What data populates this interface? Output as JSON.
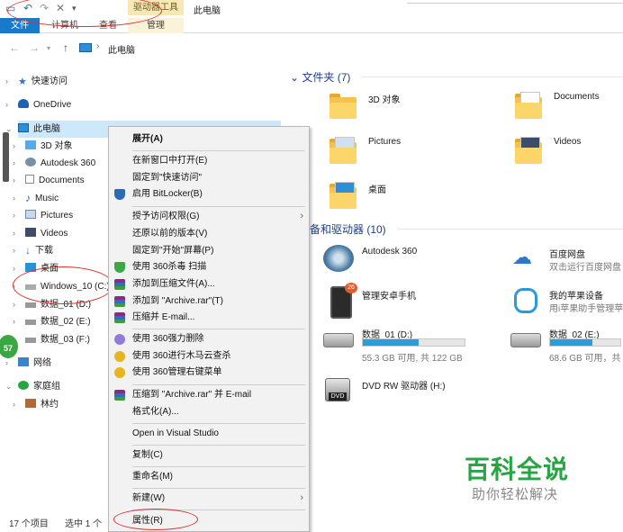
{
  "ribbon": {
    "context_group": "驱动器工具",
    "window_title": "此电脑",
    "tabs": [
      "文件",
      "计算机",
      "查看",
      "管理"
    ]
  },
  "address": {
    "path": "此电脑"
  },
  "nav": {
    "items": [
      {
        "label": "快速访问",
        "icon": "star-icon"
      },
      {
        "label": "OneDrive",
        "icon": "cloud-icon"
      },
      {
        "label": "此电脑",
        "icon": "pc-icon"
      },
      {
        "label": "3D 对象",
        "icon": "3d-objects-icon"
      },
      {
        "label": "Autodesk 360",
        "icon": "autodesk-icon"
      },
      {
        "label": "Documents",
        "icon": "document-icon"
      },
      {
        "label": "Music",
        "icon": "music-icon"
      },
      {
        "label": "Pictures",
        "icon": "pictures-icon"
      },
      {
        "label": "Videos",
        "icon": "videos-icon"
      },
      {
        "label": "下载",
        "icon": "download-icon"
      },
      {
        "label": "桌面",
        "icon": "desktop-icon"
      },
      {
        "label": "Windows_10 (C:)",
        "icon": "drive-icon"
      },
      {
        "label": "数据_01 (D:)",
        "icon": "drive-icon"
      },
      {
        "label": "数据_02 (E:)",
        "icon": "drive-icon"
      },
      {
        "label": "数据_03 (F:)",
        "icon": "drive-icon"
      },
      {
        "label": "网络",
        "icon": "network-icon"
      },
      {
        "label": "家庭组",
        "icon": "homegroup-icon"
      },
      {
        "label": "林约",
        "icon": "user-icon"
      }
    ],
    "badge": "57"
  },
  "content": {
    "folders_header": "文件夹 (7)",
    "folders": [
      "3D 对象",
      "Documents",
      "Pictures",
      "Videos",
      "桌面"
    ],
    "devices_header": "备和驱动器 (10)",
    "devices": [
      {
        "name": "Autodesk 360",
        "sub": ""
      },
      {
        "name": "百度网盘",
        "sub": "双击运行百度网盘"
      },
      {
        "name": "管理安卓手机",
        "sub": ""
      },
      {
        "name": "我的苹果设备",
        "sub": "用i苹果助手管理苹"
      },
      {
        "name": "数据_01 (D:)",
        "sub": "55.3 GB 可用, 共 122 GB",
        "used": 0.55
      },
      {
        "name": "数据_02 (E:)",
        "sub": "68.6 GB 可用，共",
        "used": 0.6
      },
      {
        "name": "DVD RW 驱动器 (H:)",
        "sub": ""
      }
    ]
  },
  "menu": {
    "items": [
      "展开(A)",
      "在新窗口中打开(E)",
      "固定到\"快速访问\"",
      "启用 BitLocker(B)",
      "授予访问权限(G)",
      "还原以前的版本(V)",
      "固定到\"开始\"屏幕(P)",
      "使用 360杀毒 扫描",
      "添加到压缩文件(A)...",
      "添加到 \"Archive.rar\"(T)",
      "压缩并 E-mail...",
      "使用 360强力删除",
      "使用 360进行木马云查杀",
      "使用 360管理右键菜单",
      "压缩到 \"Archive.rar\" 并 E-mail",
      "格式化(A)...",
      "Open in Visual Studio",
      "复制(C)",
      "重命名(M)",
      "新建(W)",
      "属性(R)"
    ]
  },
  "status": {
    "count": "17 个项目",
    "selected": "选中 1 个项"
  },
  "watermark": {
    "title": "百科全说",
    "sub": "助你轻松解决"
  }
}
